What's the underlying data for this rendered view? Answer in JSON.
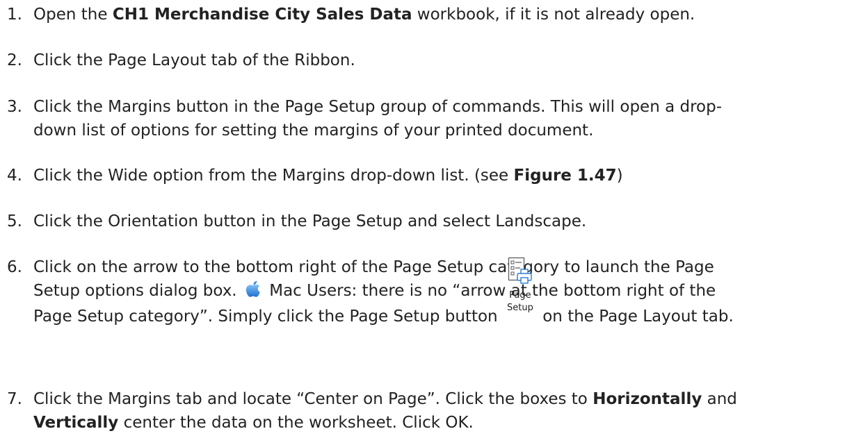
{
  "steps": [
    {
      "num": "1.",
      "pre": "Open the ",
      "bold": "CH1 Merchandise City Sales Data",
      "post": " workbook, if it is not already open."
    },
    {
      "num": "2.",
      "text": "Click the Page Layout tab of the Ribbon."
    },
    {
      "num": "3.",
      "line1": "Click the Margins button in the Page Setup group of commands. This will open a drop-",
      "line2": "down list of options for setting the margins of your printed document."
    },
    {
      "num": "4.",
      "pre": "Click the Wide option from the Margins drop-down list. (see ",
      "bold": "Figure 1.47",
      "post": ")"
    },
    {
      "num": "5.",
      "text": "Click the Orientation button in the Page Setup and select Landscape."
    },
    {
      "num": "6.",
      "line1": "Click on the arrow to the bottom right of the Page Setup category to launch the Page",
      "line2_pre": "Setup options dialog box. ",
      "line2_post": " Mac Users: there is no “arrow at the bottom right of the",
      "line3_pre": "Page Setup category”. Simply click the Page Setup button ",
      "icon_label_1": "Page",
      "icon_label_2": "Setup",
      "line3_post": " on the Page Layout tab."
    },
    {
      "num": "7.",
      "pre": "Click the Margins tab and locate “Center on Page”. Click the boxes to ",
      "bold1": "Horizontally",
      "mid": " and",
      "bold2": "Vertically",
      "post": " center the data on the worksheet. Click OK."
    }
  ],
  "icons": {
    "apple": "apple-logo-icon",
    "page_setup": "page-setup-icon"
  },
  "colors": {
    "text": "#222222",
    "apple_blue": "#2f7fd6",
    "icon_blue": "#2b7cd3"
  }
}
